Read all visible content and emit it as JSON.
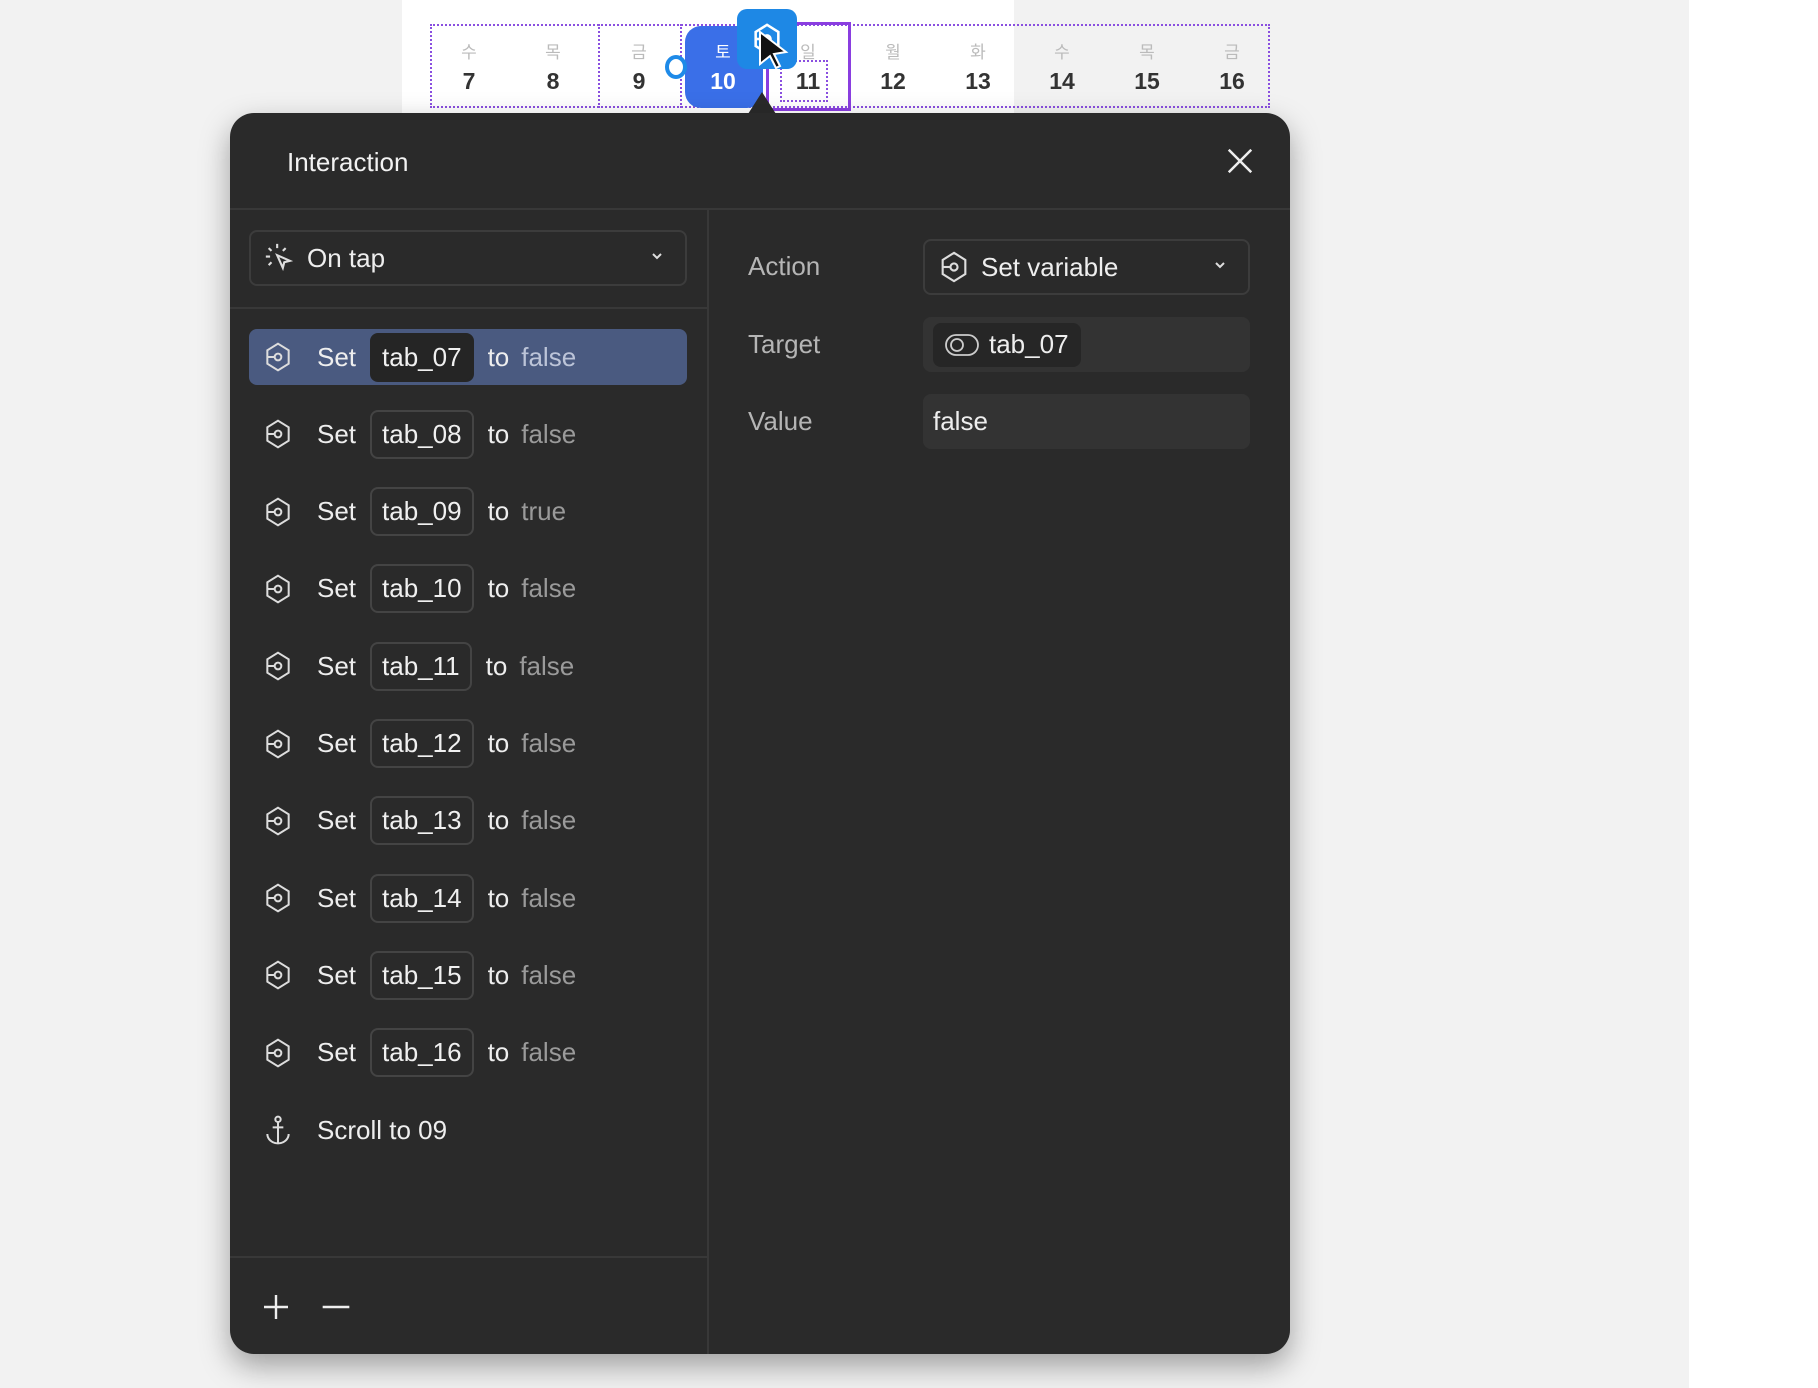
{
  "calendar": {
    "days": [
      {
        "weekday": "수",
        "date": "7"
      },
      {
        "weekday": "목",
        "date": "8"
      },
      {
        "weekday": "금",
        "date": "9"
      },
      {
        "weekday": "토",
        "date": "10"
      },
      {
        "weekday": "일",
        "date": "11"
      },
      {
        "weekday": "월",
        "date": "12"
      },
      {
        "weekday": "화",
        "date": "13"
      },
      {
        "weekday": "수",
        "date": "14"
      },
      {
        "weekday": "목",
        "date": "15"
      },
      {
        "weekday": "금",
        "date": "16"
      }
    ],
    "selected_date": "10",
    "accent_color": "#3a6fe8",
    "selection_color": "#8a3ee0"
  },
  "panel": {
    "title": "Interaction",
    "trigger": {
      "label": "On tap",
      "icon": "tap-icon"
    },
    "actions": [
      {
        "verb": "Set",
        "variable": "tab_07",
        "to": "to",
        "value": "false",
        "active": true
      },
      {
        "verb": "Set",
        "variable": "tab_08",
        "to": "to",
        "value": "false"
      },
      {
        "verb": "Set",
        "variable": "tab_09",
        "to": "to",
        "value": "true"
      },
      {
        "verb": "Set",
        "variable": "tab_10",
        "to": "to",
        "value": "false"
      },
      {
        "verb": "Set",
        "variable": "tab_11",
        "to": "to",
        "value": "false"
      },
      {
        "verb": "Set",
        "variable": "tab_12",
        "to": "to",
        "value": "false"
      },
      {
        "verb": "Set",
        "variable": "tab_13",
        "to": "to",
        "value": "false"
      },
      {
        "verb": "Set",
        "variable": "tab_14",
        "to": "to",
        "value": "false"
      },
      {
        "verb": "Set",
        "variable": "tab_15",
        "to": "to",
        "value": "false"
      },
      {
        "verb": "Set",
        "variable": "tab_16",
        "to": "to",
        "value": "false"
      },
      {
        "label": "Scroll to 09",
        "icon": "anchor-icon"
      }
    ],
    "detail": {
      "action_label": "Action",
      "action_value": "Set variable",
      "target_label": "Target",
      "target_value": "tab_07",
      "value_label": "Value",
      "value_value": "false"
    },
    "active_row_color": "#4a5a80"
  }
}
